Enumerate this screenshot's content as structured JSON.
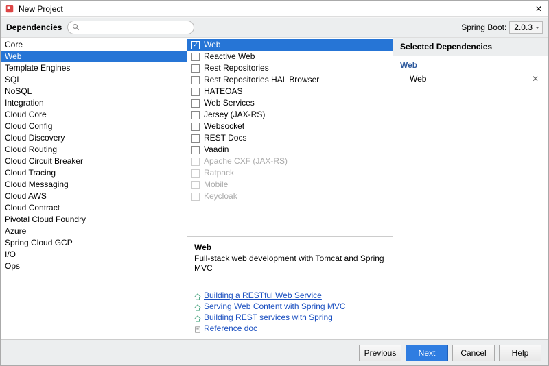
{
  "window": {
    "title": "New Project"
  },
  "header": {
    "dependencies_label": "Dependencies",
    "search_placeholder": "",
    "spring_boot_label": "Spring Boot:",
    "spring_boot_version": "2.0.3"
  },
  "categories": [
    {
      "label": "Core"
    },
    {
      "label": "Web",
      "selected": true
    },
    {
      "label": "Template Engines"
    },
    {
      "label": "SQL"
    },
    {
      "label": "NoSQL"
    },
    {
      "label": "Integration"
    },
    {
      "label": "Cloud Core"
    },
    {
      "label": "Cloud Config"
    },
    {
      "label": "Cloud Discovery"
    },
    {
      "label": "Cloud Routing"
    },
    {
      "label": "Cloud Circuit Breaker"
    },
    {
      "label": "Cloud Tracing"
    },
    {
      "label": "Cloud Messaging"
    },
    {
      "label": "Cloud AWS"
    },
    {
      "label": "Cloud Contract"
    },
    {
      "label": "Pivotal Cloud Foundry"
    },
    {
      "label": "Azure"
    },
    {
      "label": "Spring Cloud GCP"
    },
    {
      "label": "I/O"
    },
    {
      "label": "Ops"
    }
  ],
  "options": [
    {
      "label": "Web",
      "checked": true,
      "selected": true
    },
    {
      "label": "Reactive Web"
    },
    {
      "label": "Rest Repositories"
    },
    {
      "label": "Rest Repositories HAL Browser"
    },
    {
      "label": "HATEOAS"
    },
    {
      "label": "Web Services"
    },
    {
      "label": "Jersey (JAX-RS)"
    },
    {
      "label": "Websocket"
    },
    {
      "label": "REST Docs"
    },
    {
      "label": "Vaadin"
    },
    {
      "label": "Apache CXF (JAX-RS)",
      "disabled": true
    },
    {
      "label": "Ratpack",
      "disabled": true
    },
    {
      "label": "Mobile",
      "disabled": true
    },
    {
      "label": "Keycloak",
      "disabled": true
    }
  ],
  "description": {
    "title": "Web",
    "text": "Full-stack web development with Tomcat and Spring MVC",
    "links": [
      {
        "label": "Building a RESTful Web Service",
        "icon": "home"
      },
      {
        "label": "Serving Web Content with Spring MVC",
        "icon": "home"
      },
      {
        "label": "Building REST services with Spring",
        "icon": "home"
      },
      {
        "label": "Reference doc",
        "icon": "doc"
      }
    ]
  },
  "selected_panel": {
    "title": "Selected Dependencies",
    "group": "Web",
    "items": [
      {
        "label": "Web"
      }
    ]
  },
  "footer": {
    "previous": "Previous",
    "next": "Next",
    "cancel": "Cancel",
    "help": "Help"
  }
}
